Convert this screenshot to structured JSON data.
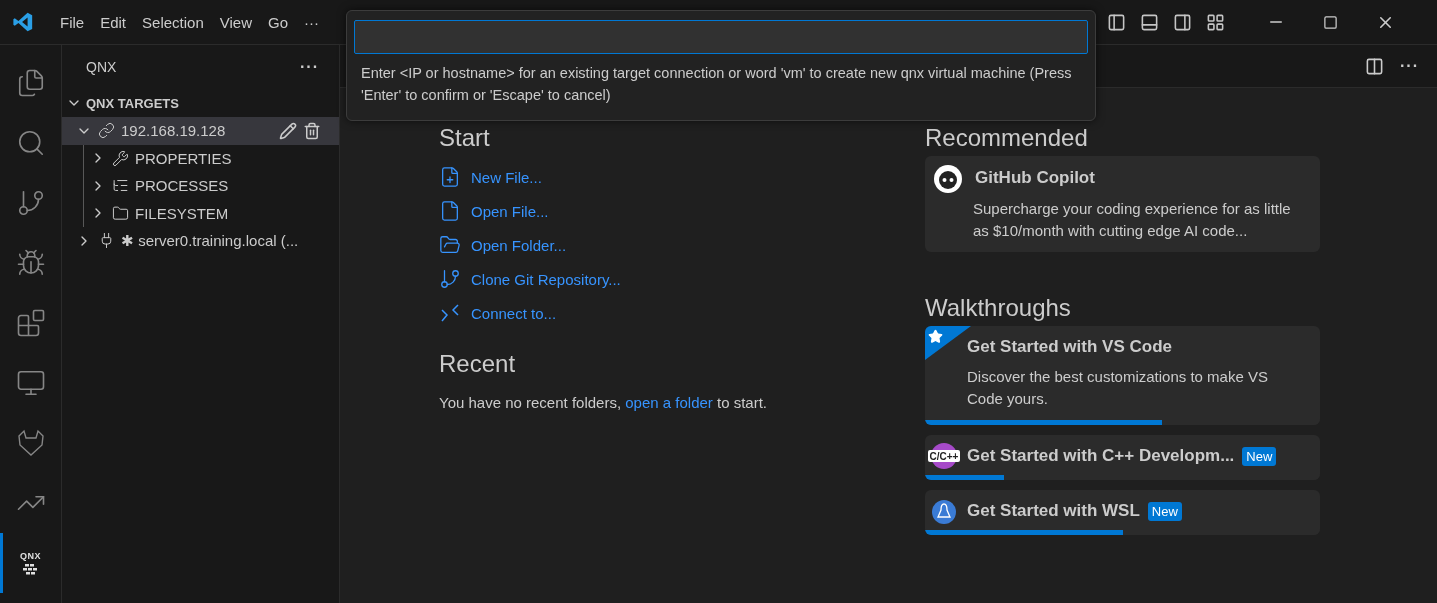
{
  "menu": [
    "File",
    "Edit",
    "Selection",
    "View",
    "Go",
    "···"
  ],
  "activity_bar": [
    {
      "kind": "explorer",
      "selected": false
    },
    {
      "kind": "search",
      "selected": false
    },
    {
      "kind": "source-control",
      "selected": false
    },
    {
      "kind": "run-debug",
      "selected": false
    },
    {
      "kind": "extensions",
      "selected": false
    },
    {
      "kind": "remote",
      "selected": false
    },
    {
      "kind": "gitlab",
      "selected": false
    },
    {
      "kind": "chart",
      "selected": false
    },
    {
      "kind": "qnx",
      "label": "QNX",
      "selected": true
    }
  ],
  "sidebar": {
    "title": "QNX",
    "more": "···",
    "section": {
      "title": "QNX TARGETS",
      "expanded": true
    },
    "targets": [
      {
        "label": "192.168.19.128",
        "kind": "connected",
        "expanded": true,
        "selected": true,
        "children": [
          {
            "label": "PROPERTIES",
            "kind": "properties",
            "expanded": false
          },
          {
            "label": "PROCESSES",
            "kind": "processes",
            "expanded": false
          },
          {
            "label": "FILESYSTEM",
            "kind": "filesystem",
            "expanded": false
          }
        ]
      },
      {
        "label": "✱ server0.training.local (...",
        "kind": "disconnected",
        "expanded": false,
        "selected": false
      }
    ]
  },
  "editor_actions": {
    "more": "···"
  },
  "quick_input": {
    "message": "Enter <IP or hostname> for an existing target connection or word 'vm' to create new qnx virtual machine (Press 'Enter' to confirm or 'Escape' to cancel)"
  },
  "welcome": {
    "start": {
      "title": "Start",
      "items": [
        {
          "kind": "new-file",
          "label": "New File..."
        },
        {
          "kind": "open-file",
          "label": "Open File..."
        },
        {
          "kind": "open-folder",
          "label": "Open Folder..."
        },
        {
          "kind": "clone",
          "label": "Clone Git Repository..."
        },
        {
          "kind": "connect",
          "label": "Connect to..."
        }
      ]
    },
    "recent": {
      "title": "Recent",
      "text_before": "You have no recent folders, ",
      "link": "open a folder",
      "text_after": " to start."
    },
    "recommended": {
      "title": "Recommended",
      "cards": [
        {
          "title": "GitHub Copilot",
          "description": "Supercharge your coding experience for as little as $10/month with cutting edge AI code..."
        }
      ]
    },
    "walkthroughs": {
      "title": "Walkthroughs",
      "items": [
        {
          "kind": "vscode",
          "title": "Get Started with VS Code",
          "description": "Discover the best customizations to make VS Code yours.",
          "level": 0.6
        },
        {
          "kind": "cpp",
          "icon_text": "C/C++",
          "title": "Get Started with C++ Developm...",
          "badge": "New",
          "level": 0.2
        },
        {
          "kind": "wsl",
          "title": "Get Started with WSL",
          "badge": "New",
          "level": 0.5
        }
      ]
    }
  }
}
